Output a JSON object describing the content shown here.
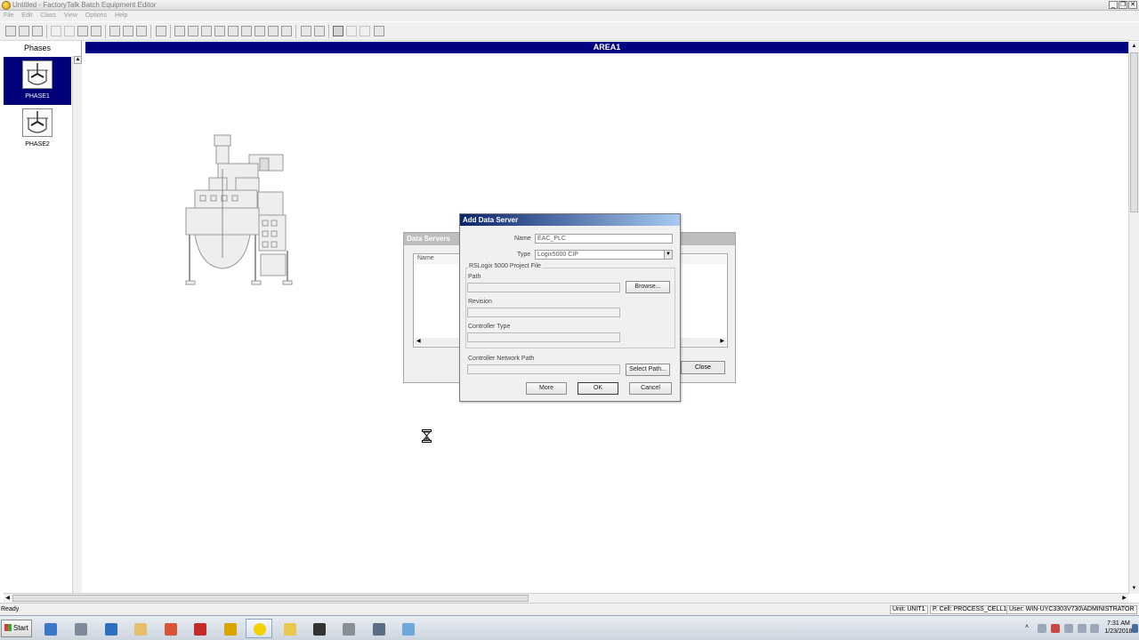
{
  "window": {
    "title": "Untitled - FactoryTalk Batch Equipment Editor",
    "buttons": [
      "_",
      "❒",
      "✕"
    ]
  },
  "menu": [
    "File",
    "Edit",
    "Class",
    "View",
    "Options",
    "Help"
  ],
  "phases_panel": {
    "header": "Phases",
    "items": [
      {
        "label": "PHASE1",
        "selected": true
      },
      {
        "label": "PHASE2",
        "selected": false
      }
    ]
  },
  "main": {
    "area_title": "AREA1"
  },
  "data_servers_dialog": {
    "title": "Data Servers",
    "column_name": "Name",
    "close_label": "Close"
  },
  "add_data_server_dialog": {
    "title": "Add Data Server",
    "name_label": "Name",
    "name_value": "EAC_PLC",
    "type_label": "Type",
    "type_value": "Logix5000 CIP",
    "group_label": "RSLogix 5000 Project File",
    "path_label": "Path",
    "path_value": "",
    "browse_label": "Browse...",
    "revision_label": "Revision",
    "revision_value": "",
    "controller_type_label": "Controller Type",
    "controller_type_value": "",
    "network_path_label": "Controller Network Path",
    "network_path_value": "",
    "select_path_label": "Select Path...",
    "more_label": "More",
    "ok_label": "OK",
    "cancel_label": "Cancel"
  },
  "statusbar": {
    "ready": "Ready",
    "unit": "Unit: UNIT1",
    "pcell": "P. Cell: PROCESS_CELL1",
    "user": "User: WIN-UYC3303V730\\ADMINISTRATOR"
  },
  "taskbar": {
    "start_label": "Start",
    "time": "7:31 AM",
    "date": "1/23/2018"
  },
  "colors": {
    "area_header": "#000080",
    "selected_phase": "#000078",
    "dialog_title": "#0a246a"
  }
}
